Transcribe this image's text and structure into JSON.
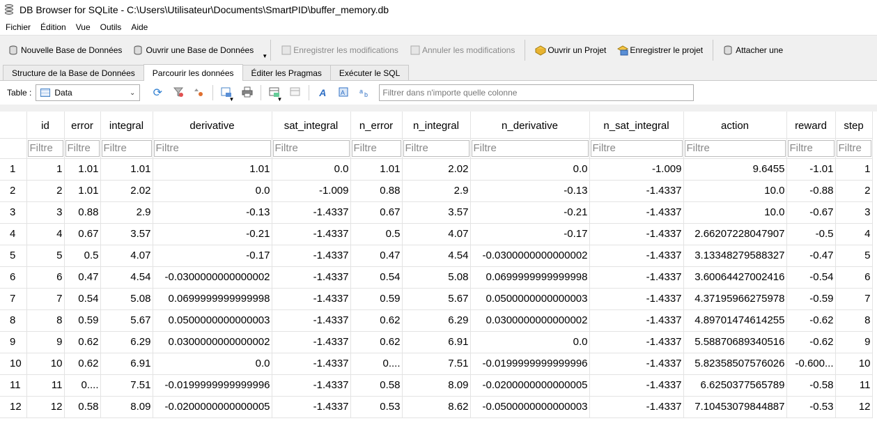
{
  "window": {
    "title": "DB Browser for SQLite - C:\\Users\\Utilisateur\\Documents\\SmartPID\\buffer_memory.db"
  },
  "menu": [
    "Fichier",
    "Édition",
    "Vue",
    "Outils",
    "Aide"
  ],
  "toolbar": {
    "new_db": "Nouvelle Base de Données",
    "open_db": "Ouvrir une Base de Données",
    "write_changes": "Enregistrer les modifications",
    "revert_changes": "Annuler les modifications",
    "open_project": "Ouvrir un Projet",
    "save_project": "Enregistrer le projet",
    "attach": "Attacher une"
  },
  "tabs": [
    "Structure de la Base de Données",
    "Parcourir les données",
    "Éditer les Pragmas",
    "Exécuter le SQL"
  ],
  "active_tab": 1,
  "browse": {
    "table_label": "Table :",
    "table_value": "Data",
    "filter_placeholder": "Filtrer dans n'importe quelle colonne"
  },
  "grid": {
    "filter_placeholder": "Filtre",
    "columns": [
      "id",
      "error",
      "integral",
      "derivative",
      "sat_integral",
      "n_error",
      "n_integral",
      "n_derivative",
      "n_sat_integral",
      "action",
      "reward",
      "step"
    ],
    "rows": [
      [
        "1",
        "1",
        "1.01",
        "1.01",
        "1.01",
        "0.0",
        "1.01",
        "2.02",
        "0.0",
        "-1.009",
        "9.6455",
        "-1.01",
        "1"
      ],
      [
        "2",
        "2",
        "1.01",
        "2.02",
        "0.0",
        "-1.009",
        "0.88",
        "2.9",
        "-0.13",
        "-1.4337",
        "10.0",
        "-0.88",
        "2"
      ],
      [
        "3",
        "3",
        "0.88",
        "2.9",
        "-0.13",
        "-1.4337",
        "0.67",
        "3.57",
        "-0.21",
        "-1.4337",
        "10.0",
        "-0.67",
        "3"
      ],
      [
        "4",
        "4",
        "0.67",
        "3.57",
        "-0.21",
        "-1.4337",
        "0.5",
        "4.07",
        "-0.17",
        "-1.4337",
        "2.66207228047907",
        "-0.5",
        "4"
      ],
      [
        "5",
        "5",
        "0.5",
        "4.07",
        "-0.17",
        "-1.4337",
        "0.47",
        "4.54",
        "-0.0300000000000002",
        "-1.4337",
        "3.13348279588327",
        "-0.47",
        "5"
      ],
      [
        "6",
        "6",
        "0.47",
        "4.54",
        "-0.0300000000000002",
        "-1.4337",
        "0.54",
        "5.08",
        "0.0699999999999998",
        "-1.4337",
        "3.60064427002416",
        "-0.54",
        "6"
      ],
      [
        "7",
        "7",
        "0.54",
        "5.08",
        "0.0699999999999998",
        "-1.4337",
        "0.59",
        "5.67",
        "0.0500000000000003",
        "-1.4337",
        "4.37195966275978",
        "-0.59",
        "7"
      ],
      [
        "8",
        "8",
        "0.59",
        "5.67",
        "0.0500000000000003",
        "-1.4337",
        "0.62",
        "6.29",
        "0.0300000000000002",
        "-1.4337",
        "4.89701474614255",
        "-0.62",
        "8"
      ],
      [
        "9",
        "9",
        "0.62",
        "6.29",
        "0.0300000000000002",
        "-1.4337",
        "0.62",
        "6.91",
        "0.0",
        "-1.4337",
        "5.58870689340516",
        "-0.62",
        "9"
      ],
      [
        "10",
        "10",
        "0.62",
        "6.91",
        "0.0",
        "-1.4337",
        "0....",
        "7.51",
        "-0.0199999999999996",
        "-1.4337",
        "5.82358507576026",
        "-0.600...",
        "10"
      ],
      [
        "11",
        "11",
        "0....",
        "7.51",
        "-0.0199999999999996",
        "-1.4337",
        "0.58",
        "8.09",
        "-0.0200000000000005",
        "-1.4337",
        "6.6250377565789",
        "-0.58",
        "11"
      ],
      [
        "12",
        "12",
        "0.58",
        "8.09",
        "-0.0200000000000005",
        "-1.4337",
        "0.53",
        "8.62",
        "-0.0500000000000003",
        "-1.4337",
        "7.10453079844887",
        "-0.53",
        "12"
      ]
    ]
  }
}
